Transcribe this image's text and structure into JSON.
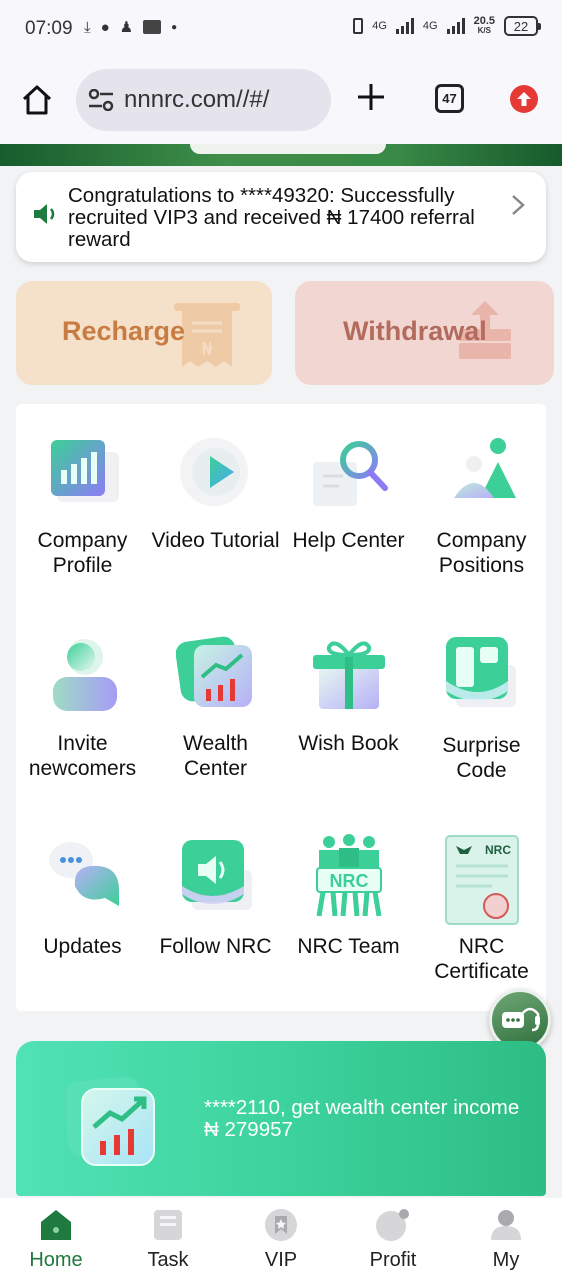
{
  "status_bar": {
    "time": "07:09",
    "net_speed_top": "20.5",
    "net_speed_unit": "K/S",
    "battery": "22",
    "signal_label_1": "4G",
    "signal_label_2": "4G"
  },
  "browser": {
    "url": "nnnrc.com//#/",
    "tab_count": "47"
  },
  "notice": {
    "text": "Congratulations to ****49320: Successfully recruited VIP3 and received ₦ 17400 referral reward"
  },
  "actions": {
    "recharge": "Recharge",
    "withdrawal": "Withdrawal"
  },
  "grid": {
    "company_profile": "Company Profile",
    "video_tutorial": "Video Tutorial",
    "help_center": "Help Center",
    "company_positions": "Company Positions",
    "invite_newcomers": "Invite newcomers",
    "wealth_center": "Wealth Center",
    "wish_book": "Wish Book",
    "surprise_code": "Surprise Code",
    "updates": "Updates",
    "follow_nrc": "Follow NRC",
    "nrc_team": "NRC Team",
    "nrc_certificate": "NRC Certificate",
    "nrc_sign_text": "NRC",
    "nrc_cert_text": "NRC"
  },
  "wealth_banner": {
    "line1": "****2110, get wealth center income",
    "line2": "₦ 279957"
  },
  "bottom_nav": {
    "home": "Home",
    "task": "Task",
    "vip": "VIP",
    "profit": "Profit",
    "my": "My"
  },
  "colors": {
    "brand_green": "#1f7a3f",
    "recharge_bg": "#f5e0c9",
    "withdraw_bg": "#f1d6d2",
    "banner_green": "#3dd39d"
  }
}
